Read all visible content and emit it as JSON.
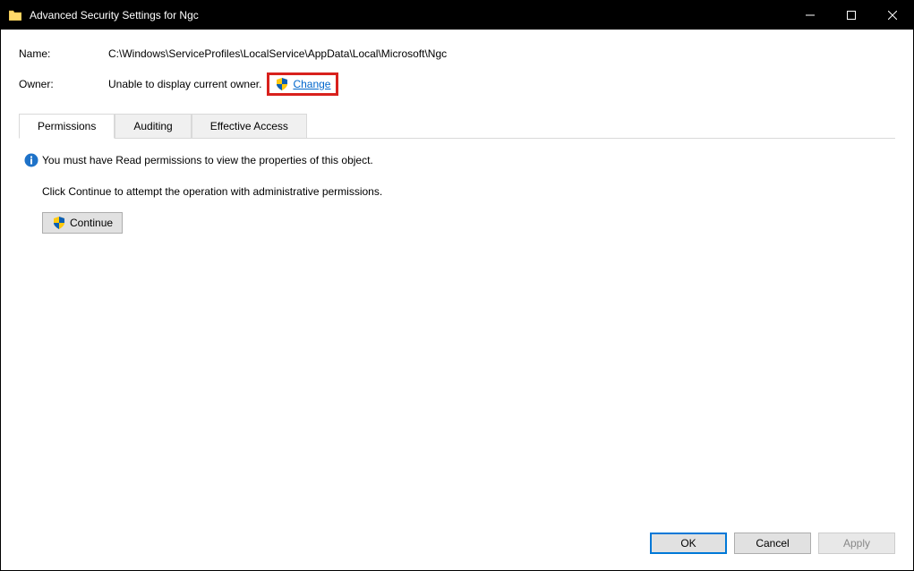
{
  "titlebar": {
    "title": "Advanced Security Settings for Ngc"
  },
  "info": {
    "name_label": "Name:",
    "name_value": "C:\\Windows\\ServiceProfiles\\LocalService\\AppData\\Local\\Microsoft\\Ngc",
    "owner_label": "Owner:",
    "owner_value": "Unable to display current owner.",
    "change_link": "Change"
  },
  "tabs": [
    {
      "label": "Permissions",
      "active": true
    },
    {
      "label": "Auditing",
      "active": false
    },
    {
      "label": "Effective Access",
      "active": false
    }
  ],
  "body": {
    "warning": "You must have Read permissions to view the properties of this object.",
    "instruction": "Click Continue to attempt the operation with administrative permissions.",
    "continue_label": "Continue"
  },
  "footer": {
    "ok": "OK",
    "cancel": "Cancel",
    "apply": "Apply"
  }
}
